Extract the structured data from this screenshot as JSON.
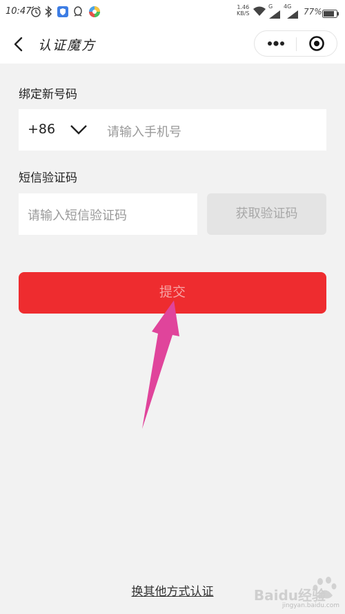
{
  "status_bar": {
    "time": "10:47",
    "speed": "1.46",
    "speed_unit": "KB/S",
    "net_label": "4G",
    "sim_label": "G",
    "battery": "77%"
  },
  "nav": {
    "title": "认证魔方"
  },
  "form": {
    "phone_label": "绑定新号码",
    "country_code": "+86",
    "phone_placeholder": "请输入手机号",
    "sms_label": "短信验证码",
    "sms_placeholder": "请输入短信验证码",
    "get_code_label": "获取验证码",
    "submit_label": "提交"
  },
  "footer": {
    "alt_method": "换其他方式认证"
  },
  "watermark": {
    "brand": "Baidu经验",
    "url": "jingyan.baidu.com"
  },
  "colors": {
    "submit_bg": "#ee2c2f",
    "arrow": "#e0449b"
  }
}
